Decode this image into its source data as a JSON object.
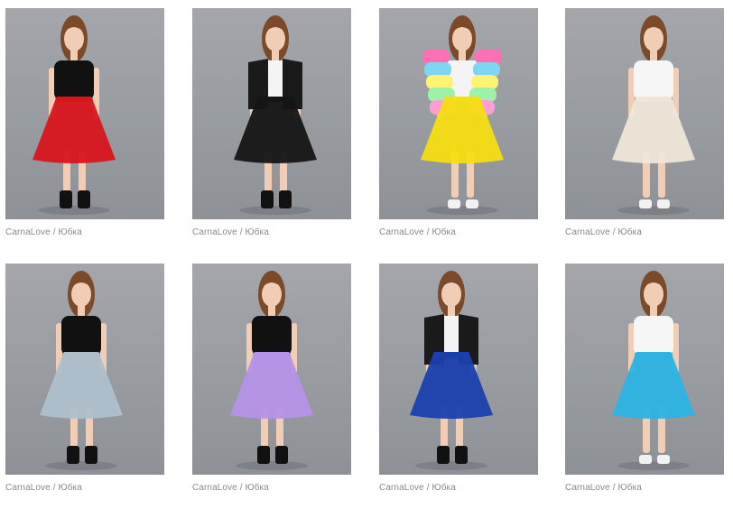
{
  "products": [
    {
      "brand": "CarnaLove",
      "separator": "/",
      "name": "Юбка",
      "skirt_color": "#d8141c",
      "skirt_color_name": "red",
      "top_color": "#111111",
      "jacket": "none",
      "shoes": "boots"
    },
    {
      "brand": "CarnaLove",
      "separator": "/",
      "name": "Юбка",
      "skirt_color": "#151515",
      "skirt_color_name": "black",
      "top_color": "#f4f4f4",
      "jacket": "black-leather",
      "shoes": "boots"
    },
    {
      "brand": "CarnaLove",
      "separator": "/",
      "name": "Юбка",
      "skirt_color": "#f5de12",
      "skirt_color_name": "yellow",
      "top_color": "#f4f4f4",
      "jacket": "rainbow-fur",
      "shoes": "sneakers"
    },
    {
      "brand": "CarnaLove",
      "separator": "/",
      "name": "Юбка",
      "skirt_color": "#efe6d9",
      "skirt_color_name": "ivory",
      "top_color": "#f6f6f6",
      "jacket": "none",
      "shoes": "sneakers"
    },
    {
      "brand": "CarnaLove",
      "separator": "/",
      "name": "Юбка",
      "skirt_color": "#aebfcb",
      "skirt_color_name": "grey-blue",
      "top_color": "#111111",
      "jacket": "none",
      "shoes": "boots"
    },
    {
      "brand": "CarnaLove",
      "separator": "/",
      "name": "Юбка",
      "skirt_color": "#b592e8",
      "skirt_color_name": "lavender",
      "top_color": "#111111",
      "jacket": "none",
      "shoes": "boots"
    },
    {
      "brand": "CarnaLove",
      "separator": "/",
      "name": "Юбка",
      "skirt_color": "#1a3fae",
      "skirt_color_name": "royal-blue",
      "top_color": "#f4f4f4",
      "jacket": "black-leather",
      "shoes": "boots"
    },
    {
      "brand": "CarnaLove",
      "separator": "/",
      "name": "Юбка",
      "skirt_color": "#2bb3e3",
      "skirt_color_name": "sky-blue",
      "top_color": "#f6f6f6",
      "jacket": "none",
      "shoes": "sneakers"
    }
  ]
}
